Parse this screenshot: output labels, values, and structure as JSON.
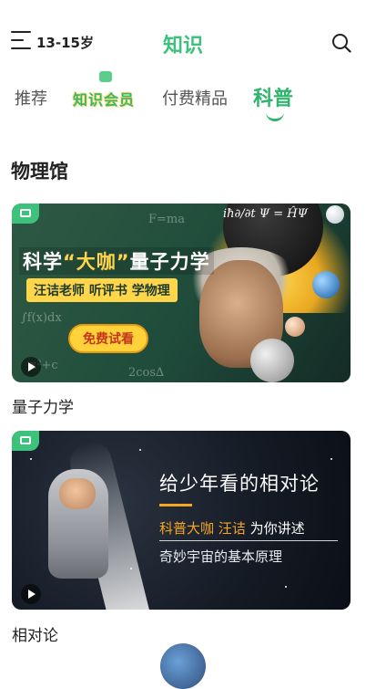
{
  "header": {
    "age_label": "13-15岁",
    "title": "知识",
    "menu_icon": "menu-icon",
    "search_icon": "search-icon",
    "accent_color": "#3cc27a"
  },
  "tabs": [
    {
      "label": "推荐",
      "active": false
    },
    {
      "label": "知识会员",
      "active": false
    },
    {
      "label": "付费精品",
      "active": false
    },
    {
      "label": "科普",
      "active": true
    }
  ],
  "section": {
    "title": "物理馆",
    "cards": [
      {
        "caption": "量子力学",
        "banner": {
          "headline_prefix": "科学",
          "headline_quote": "“大咖”",
          "headline_suffix": "量子力学",
          "subtitle": "汪诘老师 听评书 学物理",
          "button": "免费试看",
          "formula": "iħ∂/∂t Ψ = ĤΨ"
        }
      },
      {
        "caption": "相对论",
        "banner": {
          "headline": "给少年看的相对论",
          "line1_highlight": "科普大咖 汪诘",
          "line1_rest": "为你讲述",
          "line2": "奇妙宇宙的基本原理"
        }
      }
    ]
  }
}
